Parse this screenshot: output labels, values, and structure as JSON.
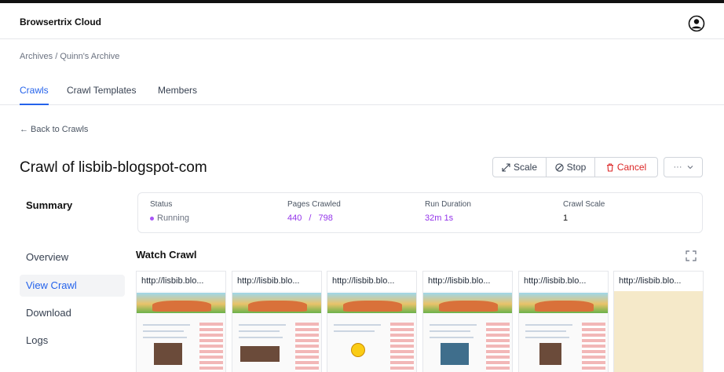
{
  "header": {
    "app_title": "Browsertrix Cloud"
  },
  "breadcrumb": "Archives / Quinn's Archive",
  "tabs": [
    {
      "label": "Crawls",
      "active": true
    },
    {
      "label": "Crawl Templates",
      "active": false
    },
    {
      "label": "Members",
      "active": false
    }
  ],
  "back_link": "← Back to Crawls",
  "page_title": "Crawl of lisbib-blogspot-com",
  "actions": {
    "scale": "Scale",
    "stop": "Stop",
    "cancel": "Cancel",
    "more": "···"
  },
  "summary": {
    "heading": "Summary",
    "status_label": "Status",
    "status_value": "Running",
    "pages_label": "Pages Crawled",
    "pages_done": "440",
    "pages_sep": "/",
    "pages_total": "798",
    "duration_label": "Run Duration",
    "duration_value": "32m 1s",
    "scale_label": "Crawl Scale",
    "scale_value": "1"
  },
  "side_nav": [
    {
      "label": "Overview",
      "active": false
    },
    {
      "label": "View Crawl",
      "active": true
    },
    {
      "label": "Download",
      "active": false
    },
    {
      "label": "Logs",
      "active": false
    }
  ],
  "watch": {
    "heading": "Watch Crawl",
    "screencasts": [
      {
        "url": "http://lisbib.blo...",
        "thumb": "photo"
      },
      {
        "url": "http://lisbib.blo...",
        "thumb": "photo"
      },
      {
        "url": "http://lisbib.blo...",
        "thumb": "smiley"
      },
      {
        "url": "http://lisbib.blo...",
        "thumb": "photo"
      },
      {
        "url": "http://lisbib.blo...",
        "thumb": "photo"
      },
      {
        "url": "http://lisbib.blo...",
        "thumb": "blank"
      }
    ]
  },
  "colors": {
    "accent": "#2563eb",
    "running": "#a855f7",
    "danger": "#dc2626"
  },
  "icons": [
    "user-circle-icon",
    "scale-icon",
    "stop-icon",
    "trash-icon",
    "chevron-down-icon",
    "expand-icon"
  ]
}
